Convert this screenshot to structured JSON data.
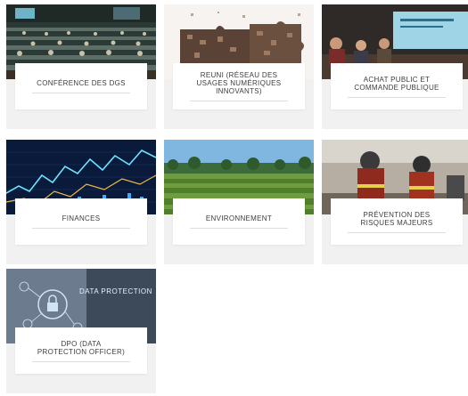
{
  "tiles": [
    {
      "label": "CONFÉRENCE DES DGS",
      "image": "conference-hall-photo"
    },
    {
      "label": "REUNI (RÉSEAU DES\nUSAGES NUMÉRIQUES\nINNOVANTS)",
      "image": "puzzle-pieces-photo"
    },
    {
      "label": "ACHAT PUBLIC ET\nCOMMANDE PUBLIQUE",
      "image": "meeting-room-photo"
    },
    {
      "label": "FINANCES",
      "image": "stock-chart-photo"
    },
    {
      "label": "ENVIRONNEMENT",
      "image": "vineyard-photo"
    },
    {
      "label": "PRÉVENTION DES\nRISQUES MAJEURS",
      "image": "firefighters-photo"
    },
    {
      "label": "DPO (DATA\nPROTECTION OFFICER)",
      "image": "data-protection-photo",
      "image_text": "DATA PROTECTION"
    }
  ],
  "colors": {
    "tile_bg": "#f1f1f1",
    "card_bg": "#ffffff",
    "text": "#3d3d3d"
  }
}
